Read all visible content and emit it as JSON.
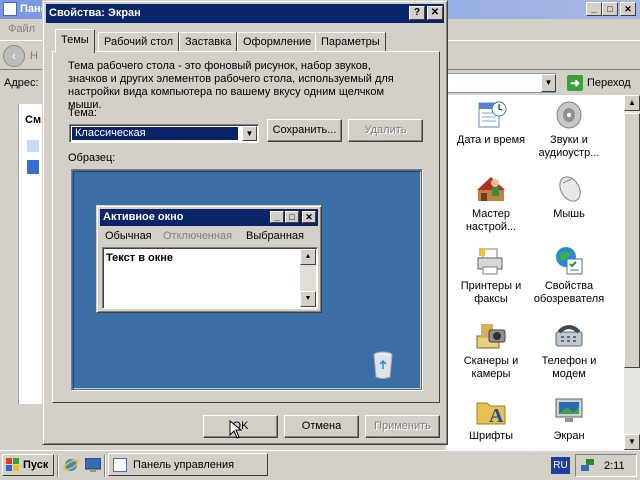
{
  "background_window": {
    "title": "Пане",
    "menu_file": "Файл",
    "back_label": "Н",
    "address_label": "Адрес:",
    "go_label": "Переход",
    "left_panel_title": "См.",
    "items": [
      {
        "label": "Дата и время",
        "icon": "calendar-clock-icon"
      },
      {
        "label": "Звуки и аудиоустр...",
        "icon": "speaker-icon"
      },
      {
        "label": "Мастер настрой...",
        "icon": "network-wizard-icon"
      },
      {
        "label": "Мышь",
        "icon": "mouse-icon"
      },
      {
        "label": "Принтеры и факсы",
        "icon": "printer-icon"
      },
      {
        "label": "Свойства обозревателя",
        "icon": "internet-options-icon"
      },
      {
        "label": "Сканеры и камеры",
        "icon": "scanner-camera-icon"
      },
      {
        "label": "Телефон и модем",
        "icon": "phone-modem-icon"
      },
      {
        "label": "Шрифты",
        "icon": "fonts-folder-icon"
      },
      {
        "label": "Экран",
        "icon": "display-icon"
      }
    ]
  },
  "dialog": {
    "title": "Свойства: Экран",
    "help_btn": "?",
    "close_btn": "✕",
    "tabs": [
      "Темы",
      "Рабочий стол",
      "Заставка",
      "Оформление",
      "Параметры"
    ],
    "description": "Тема рабочего стола - это фоновый рисунок, набор звуков, значков и других элементов рабочего стола, используемый для настройки вида компьютера по вашему вкусу одним щелчком мыши.",
    "theme_label": "Тема:",
    "theme_value": "Классическая",
    "save_btn": "Сохранить...",
    "delete_btn": "Удалить",
    "sample_label": "Образец:",
    "ok_btn": "OK",
    "cancel_btn": "Отмена",
    "apply_btn": "Применить"
  },
  "sample_window": {
    "title": "Активное окно",
    "menu": [
      "Обычная",
      "Отключенная",
      "Выбранная"
    ],
    "text": "Текст в окне"
  },
  "taskbar": {
    "start_label": "Пуск",
    "task_label": "Панель управления",
    "lang": "RU",
    "clock": "2:11"
  }
}
